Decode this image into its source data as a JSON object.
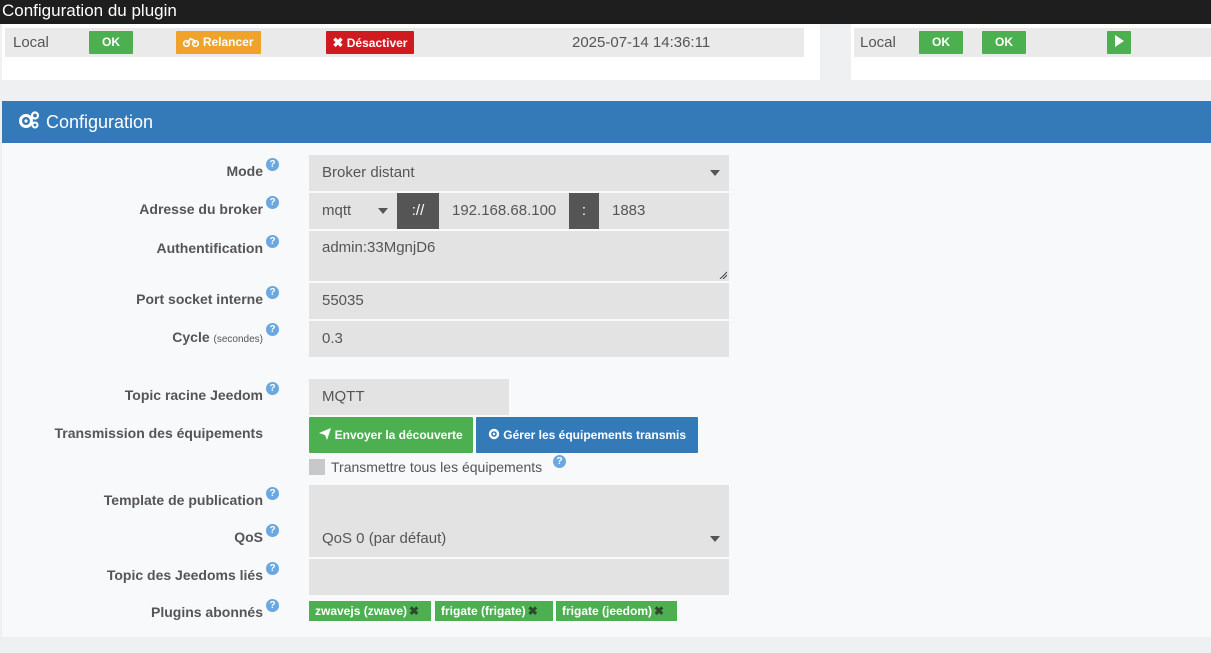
{
  "header": {
    "title": "Configuration du plugin"
  },
  "status_left": {
    "location": "Local",
    "state": "OK",
    "restart_label": "Relancer",
    "disable_label": "Désactiver",
    "timestamp": "2025-07-14 14:36:11"
  },
  "status_right": {
    "location": "Local",
    "state1": "OK",
    "state2": "OK"
  },
  "config": {
    "title": "Configuration",
    "mode": {
      "label": "Mode",
      "value": "Broker distant"
    },
    "broker": {
      "label": "Adresse du broker",
      "protocol": "mqtt",
      "separator": "://",
      "host": "192.168.68.100",
      "colon": ":",
      "port": "1883"
    },
    "auth": {
      "label": "Authentification",
      "value": "admin:33MgnjD6"
    },
    "socket": {
      "label": "Port socket interne",
      "value": "55035"
    },
    "cycle": {
      "label": "Cycle",
      "unit": "(secondes)",
      "value": "0.3"
    },
    "root_topic": {
      "label": "Topic racine Jeedom",
      "placeholder": "MQTT"
    },
    "transmission": {
      "label": "Transmission des équipements",
      "send_discovery": "Envoyer la découverte",
      "manage": "Gérer les équipements transmis",
      "transmit_all": "Transmettre tous les équipements"
    },
    "template": {
      "label": "Template de publication",
      "value": ""
    },
    "qos": {
      "label": "QoS",
      "value": "QoS 0 (par défaut)"
    },
    "linked_topic": {
      "label": "Topic des Jeedoms liés",
      "value": ""
    },
    "plugins": {
      "label": "Plugins abonnés",
      "tags": [
        "zwavejs (zwave)",
        "frigate (frigate)",
        "frigate (jeedom)"
      ]
    }
  },
  "colors": {
    "primary": "#347ab8",
    "success": "#4caf50",
    "warning": "#f0a32a",
    "danger": "#cf1b20"
  }
}
